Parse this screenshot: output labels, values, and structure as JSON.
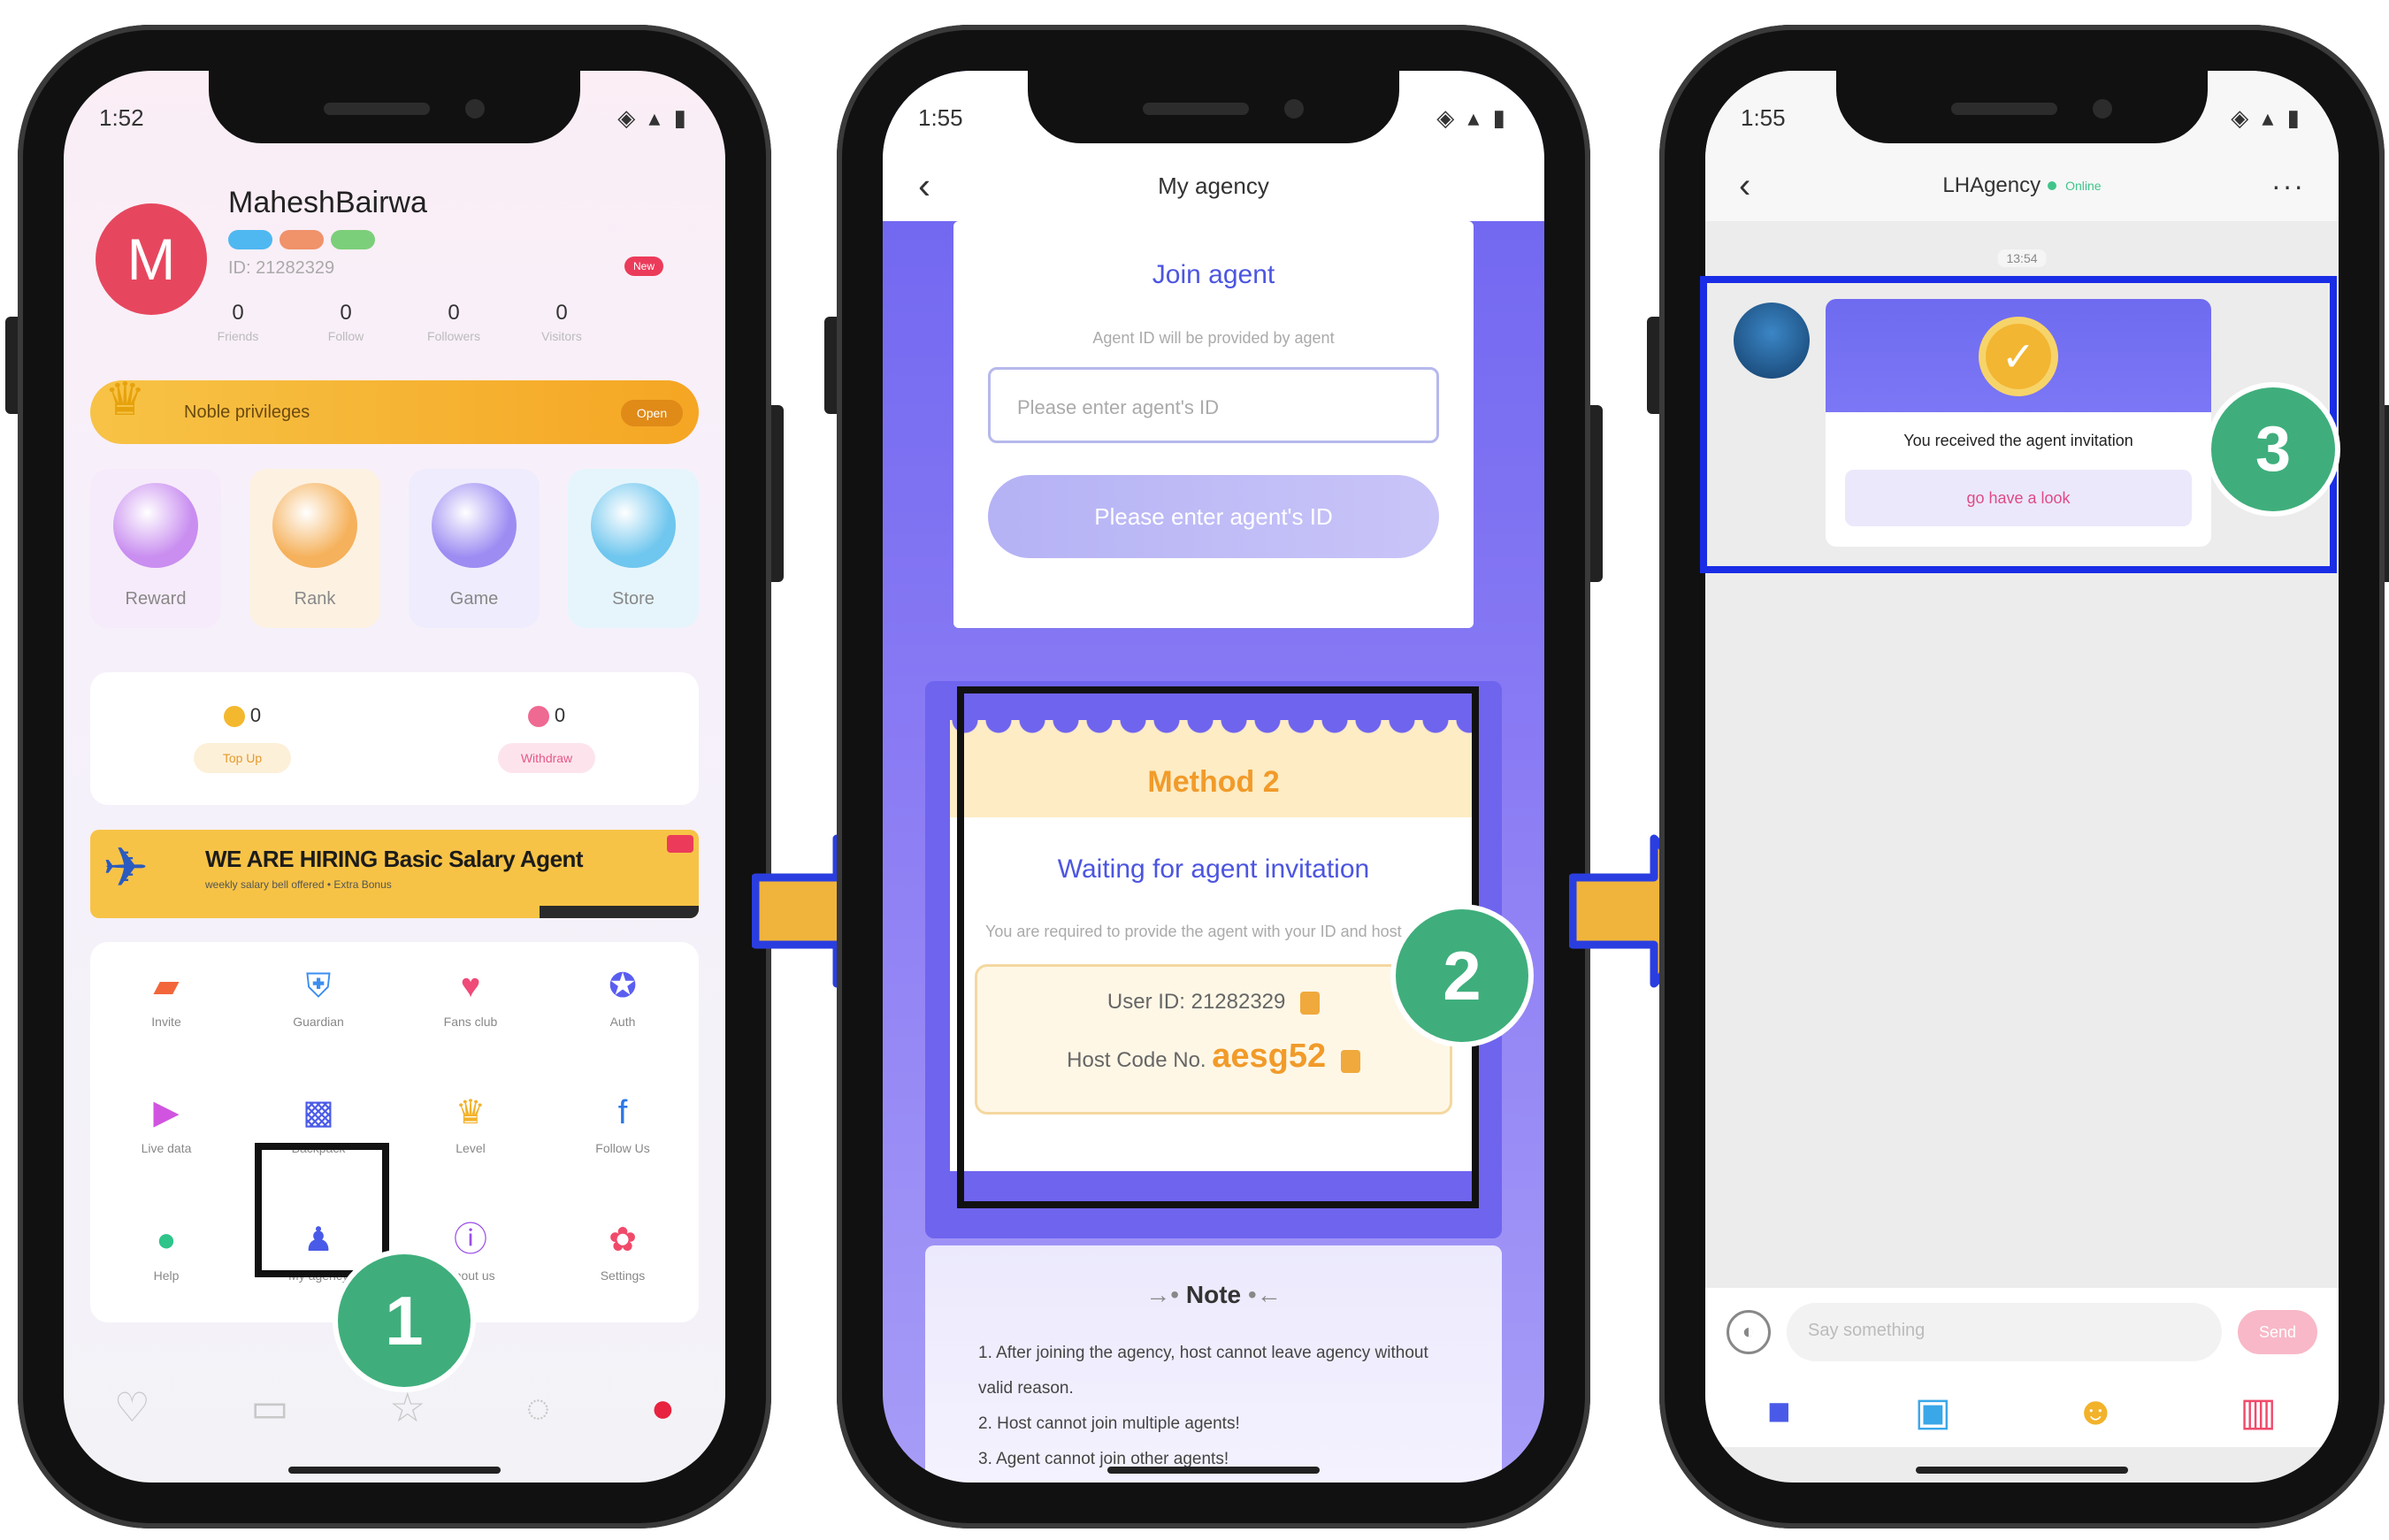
{
  "phone1": {
    "status_time": "1:52",
    "user": {
      "avatar_letter": "M",
      "name": "MaheshBairwa",
      "id_text": "ID: 21282329",
      "new_tag": "New"
    },
    "stats": [
      {
        "value": "0",
        "label": "Friends"
      },
      {
        "value": "0",
        "label": "Follow"
      },
      {
        "value": "0",
        "label": "Followers"
      },
      {
        "value": "0",
        "label": "Visitors"
      }
    ],
    "noble": {
      "label": "Noble privileges",
      "button": "Open"
    },
    "features": [
      {
        "label": "Reward",
        "color": "#c98ef0",
        "bg": "#f6ebfa"
      },
      {
        "label": "Rank",
        "color": "#f5b15b",
        "bg": "#fdf1e2"
      },
      {
        "label": "Game",
        "color": "#9d8cf2",
        "bg": "#efecfd"
      },
      {
        "label": "Store",
        "color": "#6fc6ee",
        "bg": "#e6f5fc"
      }
    ],
    "wallet": [
      {
        "amount": "0",
        "button": "Top Up",
        "coin": "#f4b82e",
        "btn_bg": "#fdf0d8",
        "btn_color": "#e59a2c"
      },
      {
        "amount": "0",
        "button": "Withdraw",
        "coin": "#ee6a92",
        "btn_bg": "#fde4ec",
        "btn_color": "#e6578a"
      }
    ],
    "hiring": {
      "headline": "WE ARE HIRING Basic Salary Agent",
      "subline": "weekly salary bell offered • Extra Bonus"
    },
    "menu": [
      {
        "label": "Invite",
        "icon": "gift",
        "color": "#f2663a"
      },
      {
        "label": "Guardian",
        "icon": "shield",
        "color": "#3b8ef0"
      },
      {
        "label": "Fans club",
        "icon": "hearts",
        "color": "#f04a78"
      },
      {
        "label": "Auth",
        "icon": "badge",
        "color": "#5a5ef0"
      },
      {
        "label": "Live data",
        "icon": "video",
        "color": "#d054e0"
      },
      {
        "label": "Backpack",
        "icon": "bag",
        "color": "#4a5ae8"
      },
      {
        "label": "Level",
        "icon": "crown",
        "color": "#f2b22a"
      },
      {
        "label": "Follow Us",
        "icon": "facebook",
        "color": "#2b77e8"
      },
      {
        "label": "Help",
        "icon": "chat",
        "color": "#2fc48a"
      },
      {
        "label": "My agency",
        "icon": "person",
        "color": "#4a5ae8"
      },
      {
        "label": "About us",
        "icon": "info",
        "color": "#9b4ee8"
      },
      {
        "label": "Settings",
        "icon": "gear",
        "color": "#f04a6a"
      }
    ],
    "step": "1"
  },
  "phone2": {
    "status_time": "1:55",
    "title": "My agency",
    "join": {
      "title": "Join agent",
      "subtitle": "Agent ID will be provided by agent",
      "placeholder": "Please enter agent's ID",
      "button": "Please enter agent's ID"
    },
    "method2": {
      "title": "Method 2",
      "heading": "Waiting for agent invitation",
      "description": "You are required to provide the agent with your ID and host code",
      "user_id_label": "User ID: 21282329",
      "host_code_label": "Host Code No.",
      "host_code": "aesg52"
    },
    "note": {
      "title": "Note",
      "lines": [
        "1. After joining the agency, host cannot leave agency without valid reason.",
        "2. Host cannot join multiple agents!",
        "3. Agent cannot join other agents!"
      ]
    },
    "step": "2"
  },
  "phone3": {
    "status_time": "1:55",
    "title": "LHAgency",
    "online": "Online",
    "timestamp": "13:54",
    "message": {
      "text": "You received the agent invitation",
      "button": "go have a look"
    },
    "input_placeholder": "Say something",
    "send": "Send",
    "step": "3"
  },
  "colors": {
    "step_badge": "#3fae7c",
    "highlight_black": "#111111",
    "highlight_blue": "#1a2de6",
    "arrow_fill": "#f0b43c",
    "arrow_stroke": "#2a3ee0",
    "agency_purple": "#6f64ee"
  }
}
